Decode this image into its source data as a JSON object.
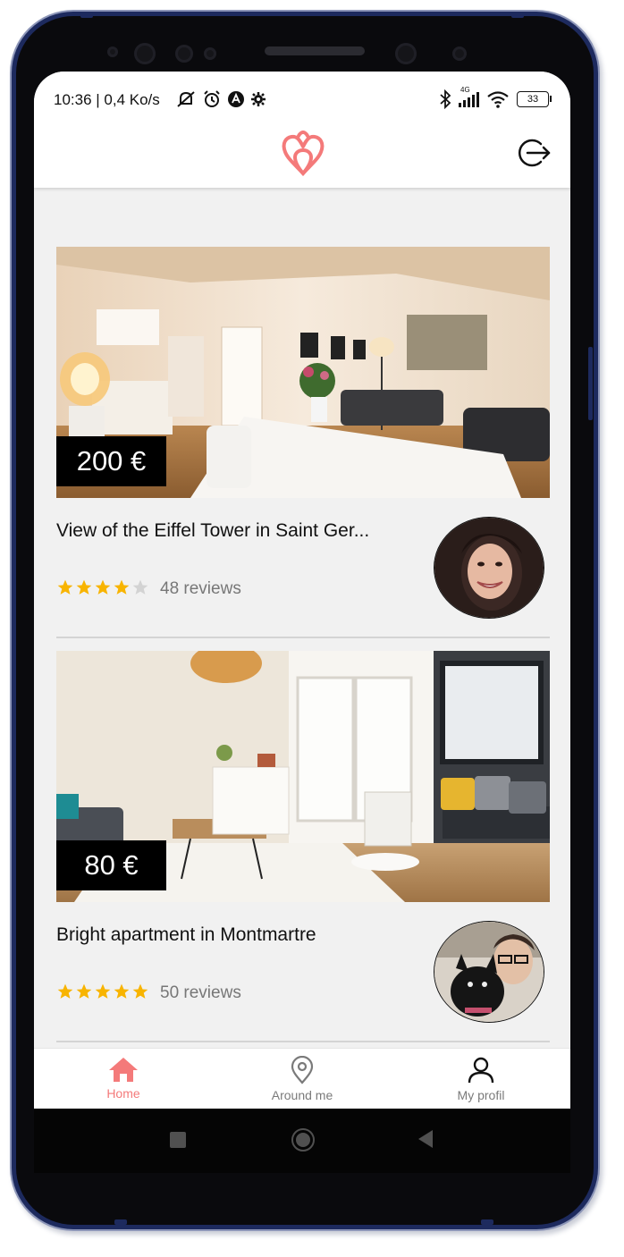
{
  "status_bar": {
    "time_speed": "10:36 | 0,4 Ko/s",
    "network_label": "4G",
    "battery": "33"
  },
  "header": {
    "logo_icon": "airbnb-logo-icon",
    "logout_icon": "logout-icon"
  },
  "colors": {
    "accent": "#f47a7a",
    "star_filled": "#f8b400",
    "star_empty": "#d3d3d3",
    "price_bg": "#000000"
  },
  "listings": [
    {
      "price": "200 €",
      "title": "View of the Eiffel Tower in Saint Ger...",
      "rating": 4,
      "max_rating": 5,
      "reviews": "48 reviews"
    },
    {
      "price": "80 €",
      "title": "Bright apartment in Montmartre",
      "rating": 5,
      "max_rating": 5,
      "reviews": "50 reviews"
    }
  ],
  "bottom_nav": {
    "items": [
      {
        "label": "Home",
        "icon": "home-icon",
        "active": true
      },
      {
        "label": "Around me",
        "icon": "map-pin-icon",
        "active": false
      },
      {
        "label": "My profil",
        "icon": "user-icon",
        "active": false
      }
    ]
  }
}
